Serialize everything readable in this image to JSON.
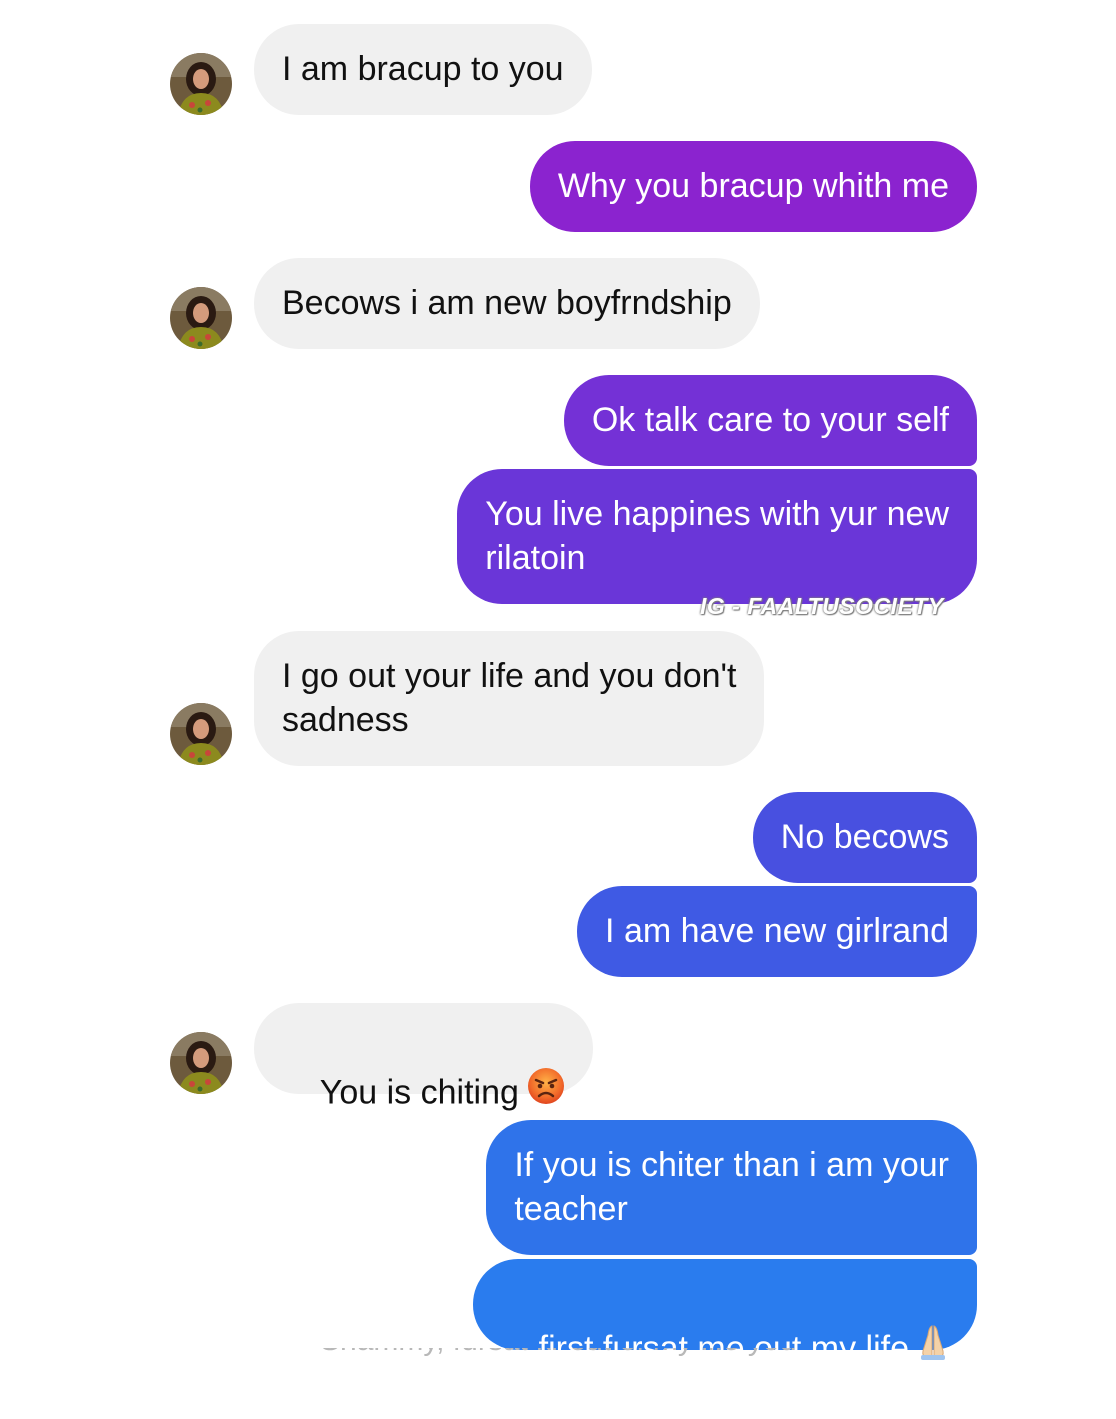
{
  "messages": [
    {
      "sender": "them",
      "text": "I am bracup to you"
    },
    {
      "sender": "me",
      "text": "Why you bracup whith me",
      "color": "#8b23cf"
    },
    {
      "sender": "them",
      "text": "Becows i am new boyfrndship"
    },
    {
      "sender": "me",
      "text": "Ok talk care to your self",
      "color": "#7431d6"
    },
    {
      "sender": "me",
      "text": "You live happines with yur new\nrilatoin",
      "color": "#6a36d8"
    },
    {
      "sender": "them",
      "text": "I go out your life and you don't\nsadness"
    },
    {
      "sender": "me",
      "text": "No becows",
      "color": "#4850e0"
    },
    {
      "sender": "me",
      "text": "I am have new girlrand",
      "color": "#3f5ae4"
    },
    {
      "sender": "them",
      "text": "You is chiting",
      "emoji": "angry-face-icon"
    },
    {
      "sender": "me",
      "text": "If you is chiter than i am your\nteacher",
      "color": "#2f73ea"
    },
    {
      "sender": "me",
      "text": "first fursat me out my life",
      "color": "#2a7cee",
      "emoji": "folded-hands-icon"
    }
  ],
  "watermark": "IG - FAALTUSOCIETY",
  "colors": {
    "incoming_bubble": "#f0f0f0",
    "incoming_text": "#111111",
    "outgoing_text": "#ffffff"
  },
  "partial_text": "Shammy, fursat kr out of my life you don't"
}
